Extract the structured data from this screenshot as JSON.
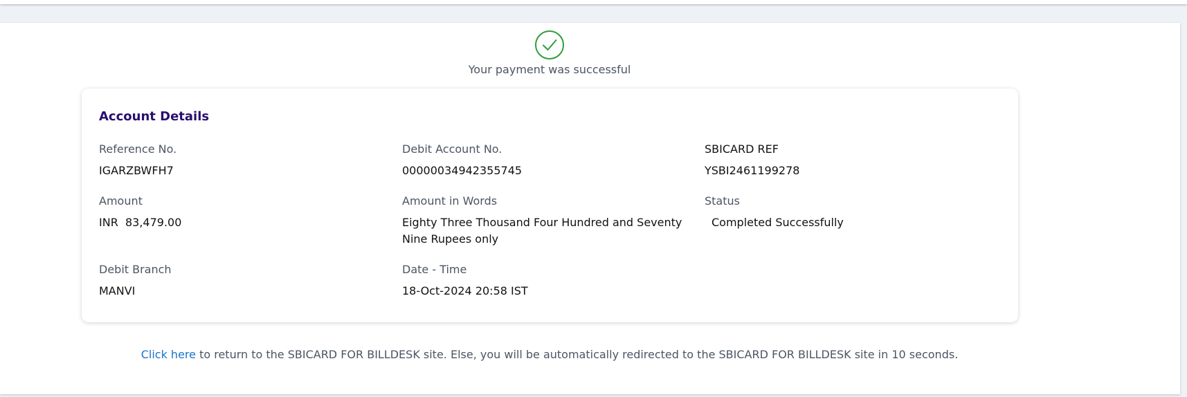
{
  "status": {
    "message": "Your payment was successful",
    "icon": "check-circle-icon",
    "icon_color": "#2e9e3a"
  },
  "account_details": {
    "title": "Account Details",
    "reference_no": {
      "label": "Reference No.",
      "value": "IGARZBWFH7"
    },
    "debit_account_no": {
      "label": "Debit Account No.",
      "value": "00000034942355745"
    },
    "sbicard_ref": {
      "label": "SBICARD REF",
      "value": "YSBI2461199278"
    },
    "amount": {
      "label": "Amount",
      "value": "INR  83,479.00"
    },
    "amount_in_words": {
      "label": "Amount in Words",
      "value": "Eighty Three Thousand Four Hundred and Seventy Nine Rupees only"
    },
    "txn_status": {
      "label": "Status",
      "value": "Completed Successfully"
    },
    "debit_branch": {
      "label": "Debit Branch",
      "value": "MANVI"
    },
    "date_time": {
      "label": "Date - Time",
      "value": "18-Oct-2024 20:58 IST"
    }
  },
  "footer": {
    "link_text": "Click here",
    "text": " to return to the SBICARD FOR BILLDESK site. Else, you will be automatically redirected to the SBICARD FOR BILLDESK site in 10 seconds."
  },
  "colors": {
    "title": "#2a0e6e",
    "link": "#1a73c9",
    "success": "#2e9e3a"
  }
}
